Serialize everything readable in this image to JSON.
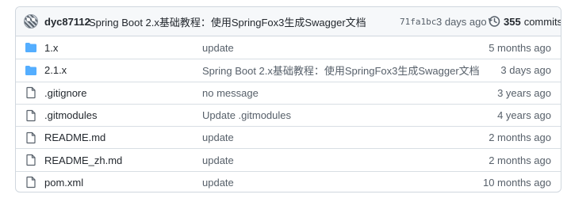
{
  "commit": {
    "author": "dyc87112",
    "message": "Spring Boot 2.x基础教程：使用SpringFox3生成Swagger文档",
    "sha": "71fa1bc",
    "age": "3 days ago",
    "count": "355",
    "count_label": "commits"
  },
  "files": [
    {
      "type": "folder",
      "name": "1.x",
      "message": "update",
      "age": "5 months ago"
    },
    {
      "type": "folder",
      "name": "2.1.x",
      "message": "Spring Boot 2.x基础教程：使用SpringFox3生成Swagger文档",
      "age": "3 days ago"
    },
    {
      "type": "file",
      "name": ".gitignore",
      "message": "no message",
      "age": "3 years ago"
    },
    {
      "type": "file",
      "name": ".gitmodules",
      "message": "Update .gitmodules",
      "age": "4 years ago"
    },
    {
      "type": "file",
      "name": "README.md",
      "message": "update",
      "age": "2 months ago"
    },
    {
      "type": "file",
      "name": "README_zh.md",
      "message": "update",
      "age": "2 months ago"
    },
    {
      "type": "file",
      "name": "pom.xml",
      "message": "update",
      "age": "10 months ago"
    }
  ],
  "colors": {
    "folder": "#54aeff",
    "file": "#57606a",
    "border": "#d0d7de"
  }
}
